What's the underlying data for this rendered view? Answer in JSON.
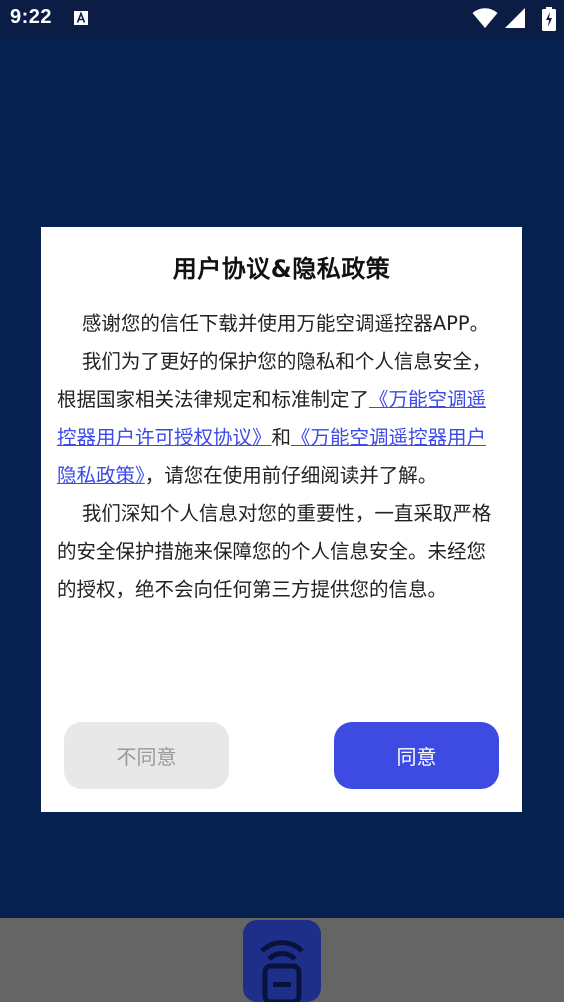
{
  "status_bar": {
    "time": "9:22",
    "icons": [
      "notification-a-icon",
      "wifi-icon",
      "signal-icon",
      "battery-icon"
    ]
  },
  "dialog": {
    "title": "用户协议&隐私政策",
    "para1": "感谢您的信任下载并使用万能空调遥控器APP。",
    "para2_before": "我们为了更好的保护您的隐私和个人信息安全，根据国家相关法律规定和标准制定了",
    "link_license": "《万能空调遥控器用户许可授权协议》",
    "para2_and": "和",
    "link_privacy": "《万能空调遥控器用户隐私政策》",
    "para2_after": "，请您在使用前仔细阅读并了解。",
    "para3": "我们深知个人信息对您的重要性，一直采取严格的安全保护措施来保障您的个人信息安全。未经您的授权，绝不会向任何第三方提供您的信息。",
    "disagree_label": "不同意",
    "agree_label": "同意"
  },
  "colors": {
    "accent": "#3d4be3",
    "link": "#3b4ae8",
    "app_background": "#06204f"
  }
}
